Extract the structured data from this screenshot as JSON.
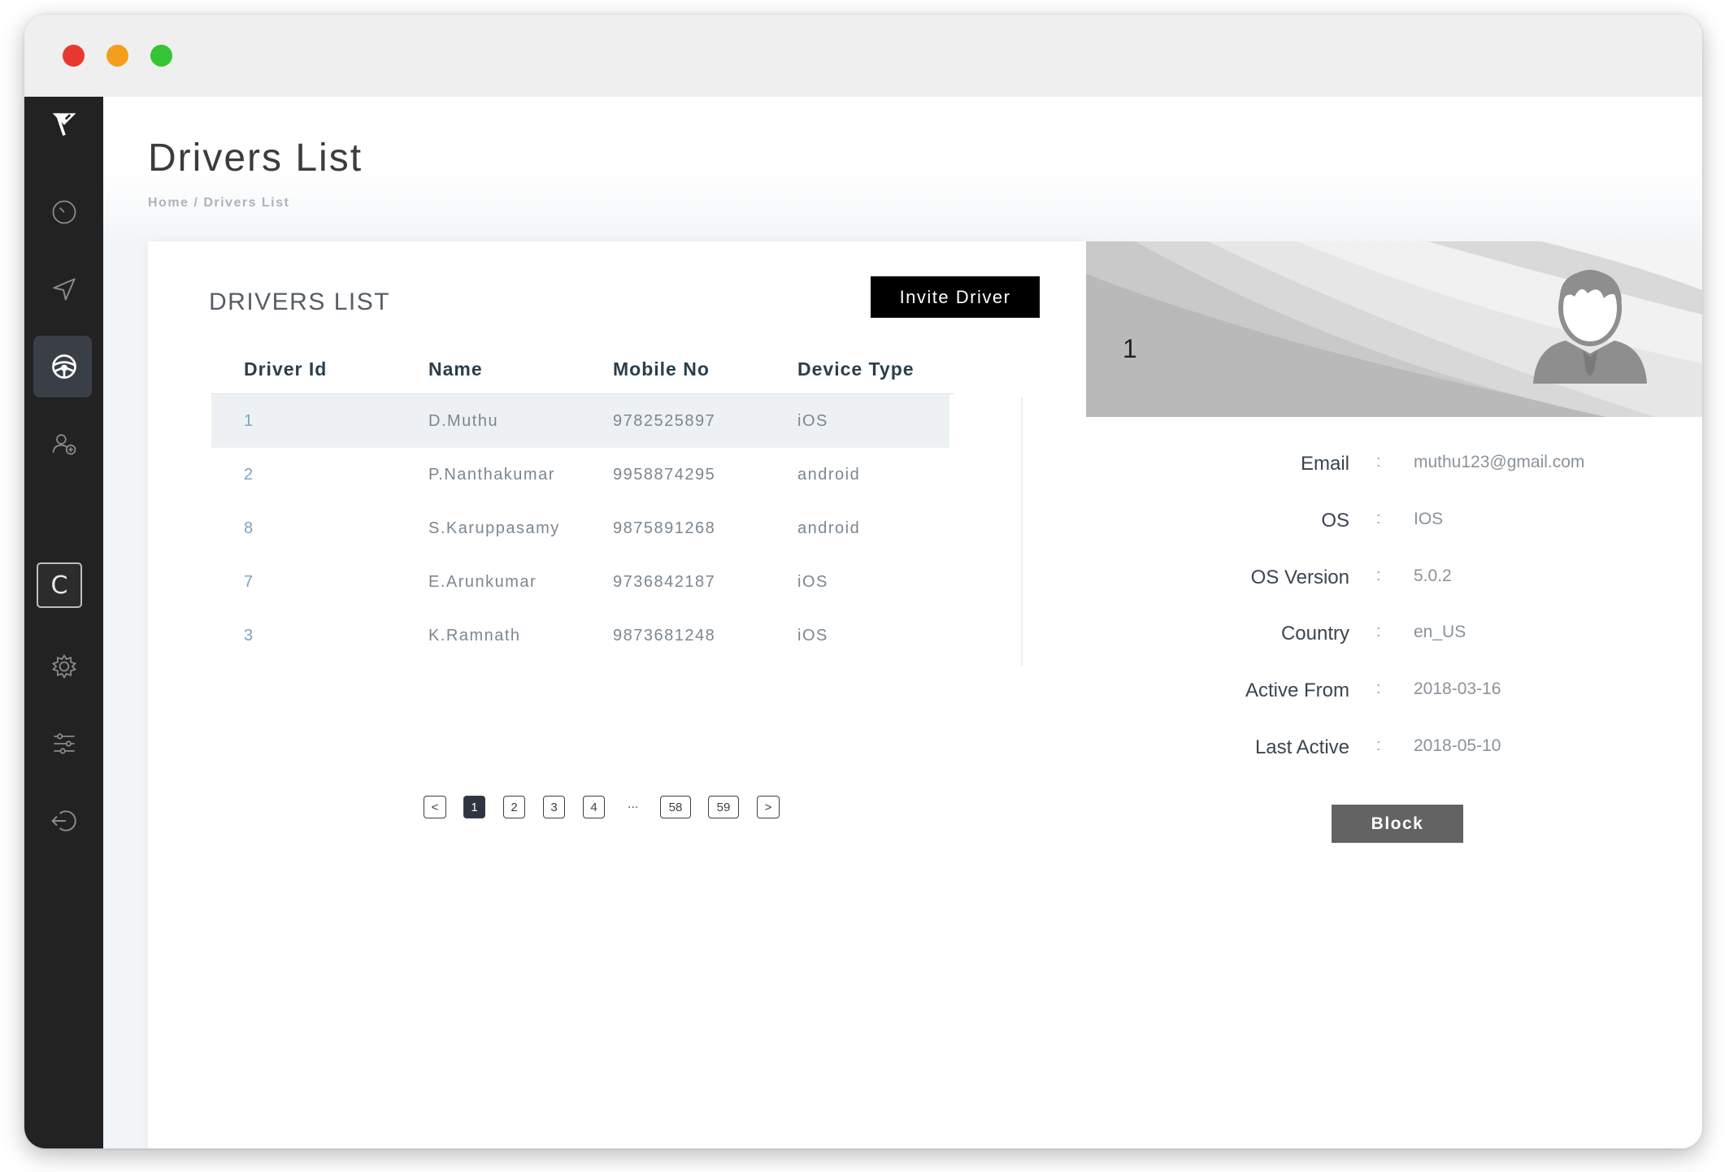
{
  "page": {
    "title": "Drivers List",
    "breadcrumb": {
      "home": "Home",
      "separator": "/",
      "current": "Drivers List"
    }
  },
  "sidebar": {
    "items": [
      {
        "icon": "logo-icon"
      },
      {
        "icon": "dashboard-icon"
      },
      {
        "icon": "navigation-icon"
      },
      {
        "icon": "steering-wheel-icon",
        "active": true
      },
      {
        "icon": "user-add-icon"
      },
      {
        "icon": "c-icon",
        "label": "C"
      },
      {
        "icon": "settings-icon"
      },
      {
        "icon": "sliders-icon"
      },
      {
        "icon": "logout-icon"
      }
    ]
  },
  "list": {
    "heading": "DRIVERS LIST",
    "invite_label": "Invite Driver",
    "columns": [
      "Driver Id",
      "Name",
      "Mobile No",
      "Device Type"
    ],
    "rows": [
      {
        "id": "1",
        "name": "D.Muthu",
        "mobile": "9782525897",
        "device": "iOS",
        "selected": true
      },
      {
        "id": "2",
        "name": "P.Nanthakumar",
        "mobile": "9958874295",
        "device": "android"
      },
      {
        "id": "8",
        "name": "S.Karuppasamy",
        "mobile": "9875891268",
        "device": "android"
      },
      {
        "id": "7",
        "name": "E.Arunkumar",
        "mobile": "9736842187",
        "device": "iOS"
      },
      {
        "id": "3",
        "name": "K.Ramnath",
        "mobile": "9873681248",
        "device": "iOS"
      }
    ],
    "pagination": {
      "prev": "<",
      "pages": [
        "1",
        "2",
        "3",
        "4"
      ],
      "ellipsis": "...",
      "last_pages": [
        "58",
        "59"
      ],
      "next": ">",
      "current": "1"
    }
  },
  "detail": {
    "number": "1",
    "fields": [
      {
        "label": "Email",
        "value": "muthu123@gmail.com"
      },
      {
        "label": "OS",
        "value": "IOS"
      },
      {
        "label": "OS Version",
        "value": "5.0.2"
      },
      {
        "label": "Country",
        "value": "en_US"
      },
      {
        "label": "Active From",
        "value": "2018-03-16"
      },
      {
        "label": "Last Active",
        "value": "2018-05-10"
      }
    ],
    "colon": ":",
    "block_label": "Block"
  },
  "colors": {
    "sidebar_bg": "#222222",
    "accent_dark": "#2e3540",
    "invite_bg": "#000000",
    "block_bg": "#636363",
    "header_text": "#2b3e4c",
    "id_text": "#7aa5c2"
  }
}
